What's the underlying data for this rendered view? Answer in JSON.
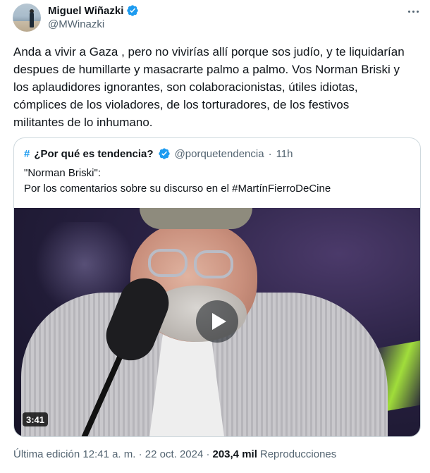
{
  "author": {
    "display_name": "Miguel Wiñazki",
    "handle": "@MWinazki"
  },
  "tweet": {
    "text": "Anda a vivir a Gaza , pero no vivirías allí porque sos judío, y te liquidarían\ndespues de humillarte y masacrarte palmo a palmo.  Vos Norman Briski y\nlos aplaudidores ignorantes, son colaboracionistas, útiles idiotas,\ncómplices de los violadores, de los torturadores, de los  festivos\nmilitantes de lo inhumano."
  },
  "quote": {
    "hash": "#",
    "name": "¿Por qué es tendencia?",
    "handle": "@porquetendencia",
    "separator": "·",
    "time": "11h",
    "text": "\"Norman Briski\":\nPor los comentarios sobre su discurso en el #MartínFierroDeCine",
    "video": {
      "duration": "3:41"
    }
  },
  "meta": {
    "edited": "Última edición 12:41 a. m. · 22 oct. 2024 ·",
    "views_count": "203,4 mil",
    "views_label": "Reproducciones"
  },
  "colors": {
    "accent": "#1d9bf0",
    "secondary_text": "#536471",
    "primary_text": "#0f1419"
  },
  "icons": [
    "verified-badge-icon",
    "more-options-icon",
    "hashtag-icon",
    "play-icon"
  ]
}
